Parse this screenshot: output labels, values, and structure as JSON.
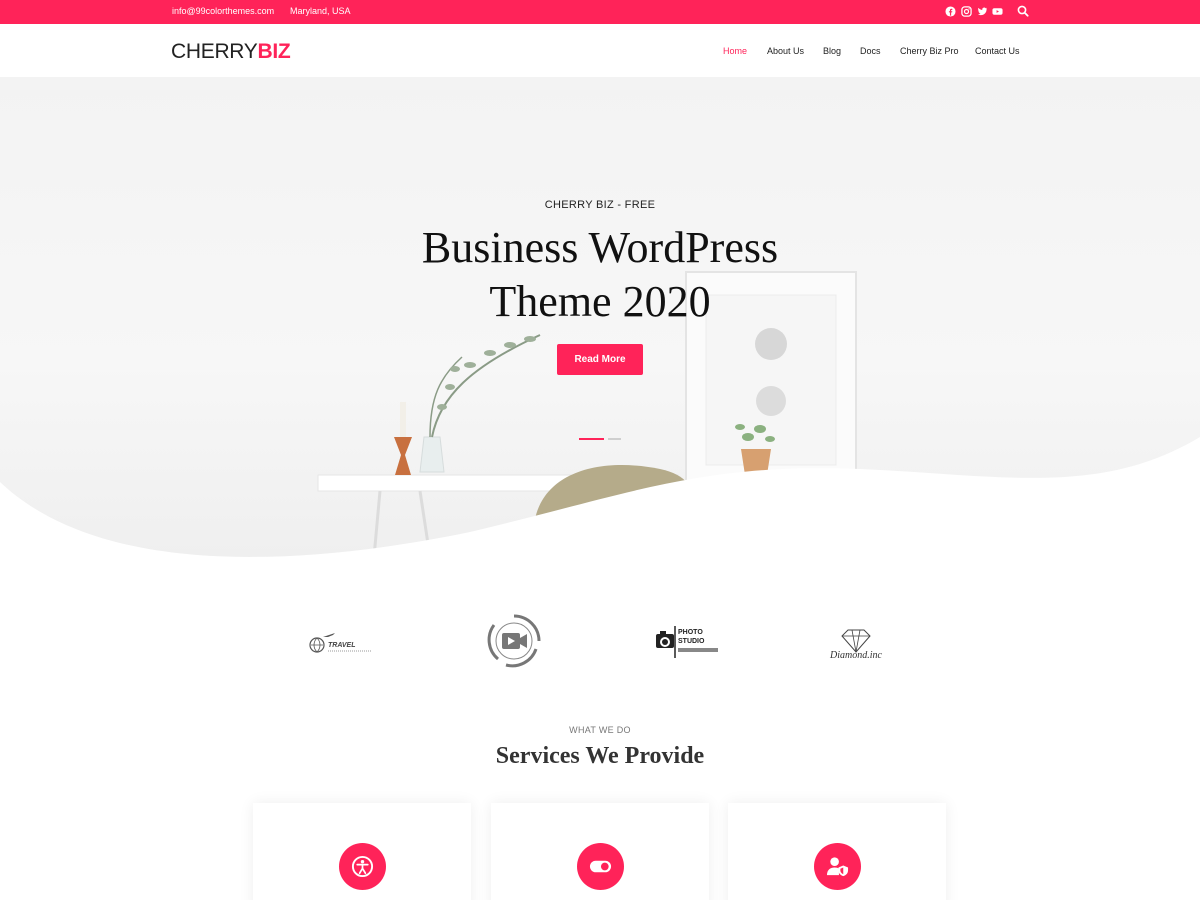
{
  "colors": {
    "accent": "#ff2359",
    "text": "#222222",
    "muted": "#777777"
  },
  "topbar": {
    "email": "info@99colorthemes.com",
    "location": "Maryland, USA",
    "icons": [
      "facebook-icon",
      "instagram-icon",
      "twitter-icon",
      "youtube-icon",
      "search-icon"
    ]
  },
  "header": {
    "logo_part1": "CHERRY",
    "logo_part2": "BIZ",
    "nav": [
      "Home",
      "About Us",
      "Blog",
      "Docs",
      "Cherry Biz Pro",
      "Contact Us"
    ],
    "active_nav": "Home"
  },
  "hero": {
    "kicker": "CHERRY BIZ - FREE",
    "title_line1": "Business WordPress",
    "title_line2": "Theme 2020",
    "button": "Read More",
    "slides": 2,
    "active_slide": 1
  },
  "brands": {
    "travel": "TRAVEL",
    "photo_line1": "PHOTO",
    "photo_line2": "STUDIO",
    "diamond": "Diamond.inc"
  },
  "services": {
    "kicker": "WHAT WE DO",
    "title": "Services We Provide",
    "icons": [
      "accessibility-icon",
      "toggle-icon",
      "user-shield-icon"
    ]
  }
}
